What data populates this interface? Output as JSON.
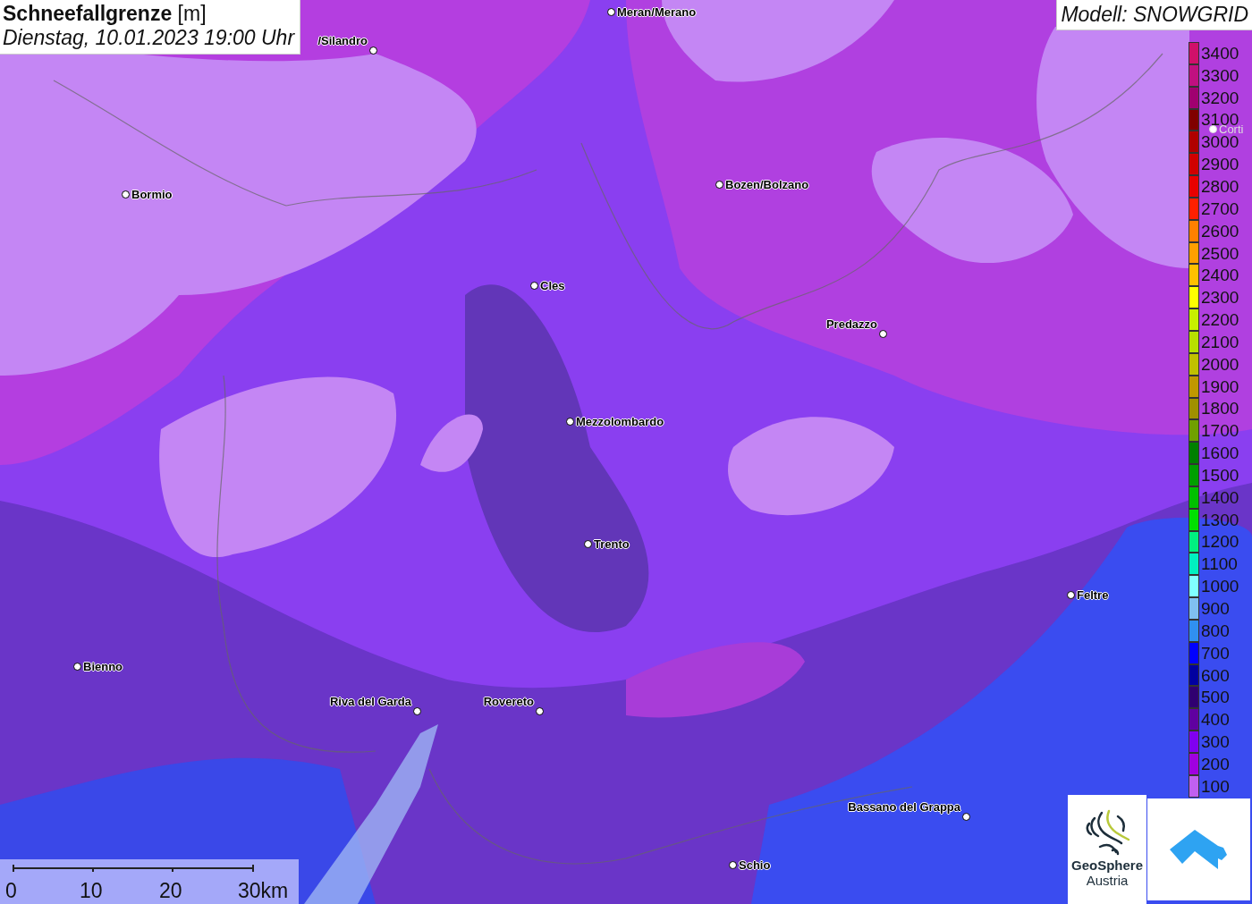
{
  "title": {
    "name": "Schneefallgrenze",
    "unit": "[m]",
    "datetime": "Dienstag, 10.01.2023 19:00 Uhr"
  },
  "model": "Modell: SNOWGRID",
  "cities": [
    {
      "name": "Meran/Merano"
    },
    {
      "name": "/Silandro"
    },
    {
      "name": "Bormio"
    },
    {
      "name": "Bozen/Bolzano"
    },
    {
      "name": "Cles"
    },
    {
      "name": "Predazzo"
    },
    {
      "name": "Mezzolombardo"
    },
    {
      "name": "Trento"
    },
    {
      "name": "Feltre"
    },
    {
      "name": "Bienno"
    },
    {
      "name": "Riva del Garda"
    },
    {
      "name": "Rovereto"
    },
    {
      "name": "Bassano del Grappa"
    },
    {
      "name": "Schio"
    },
    {
      "name": "Corti"
    }
  ],
  "legend": [
    {
      "label": "3400",
      "color": "#d0106a"
    },
    {
      "label": "3300",
      "color": "#c01080"
    },
    {
      "label": "3200",
      "color": "#a00070"
    },
    {
      "label": "3100",
      "color": "#800000"
    },
    {
      "label": "3000",
      "color": "#b00000"
    },
    {
      "label": "2900",
      "color": "#d00000"
    },
    {
      "label": "2800",
      "color": "#e80000"
    },
    {
      "label": "2700",
      "color": "#ff2000"
    },
    {
      "label": "2600",
      "color": "#ff8000"
    },
    {
      "label": "2500",
      "color": "#ffa000"
    },
    {
      "label": "2400",
      "color": "#ffc000"
    },
    {
      "label": "2300",
      "color": "#ffff00"
    },
    {
      "label": "2200",
      "color": "#c8f000"
    },
    {
      "label": "2100",
      "color": "#b8e000"
    },
    {
      "label": "2000",
      "color": "#c0c000"
    },
    {
      "label": "1900",
      "color": "#c09800"
    },
    {
      "label": "1800",
      "color": "#a09000"
    },
    {
      "label": "1700",
      "color": "#70a000"
    },
    {
      "label": "1600",
      "color": "#008000"
    },
    {
      "label": "1500",
      "color": "#00a000"
    },
    {
      "label": "1400",
      "color": "#00c000"
    },
    {
      "label": "1300",
      "color": "#00e000"
    },
    {
      "label": "1200",
      "color": "#00f080"
    },
    {
      "label": "1100",
      "color": "#00f0c0"
    },
    {
      "label": "1000",
      "color": "#80ffff"
    },
    {
      "label": "900",
      "color": "#80c0f0"
    },
    {
      "label": "800",
      "color": "#3090f0"
    },
    {
      "label": "700",
      "color": "#0000ff"
    },
    {
      "label": "600",
      "color": "#0000a0"
    },
    {
      "label": "500",
      "color": "#300070"
    },
    {
      "label": "400",
      "color": "#6000a0"
    },
    {
      "label": "300",
      "color": "#8000f0"
    },
    {
      "label": "200",
      "color": "#a000e0"
    },
    {
      "label": "100",
      "color": "#c060f0"
    }
  ],
  "scale": {
    "ticks": [
      "0",
      "10",
      "20",
      "30km"
    ]
  },
  "logo": {
    "line1": "GeoSphere",
    "line2": "Austria"
  }
}
